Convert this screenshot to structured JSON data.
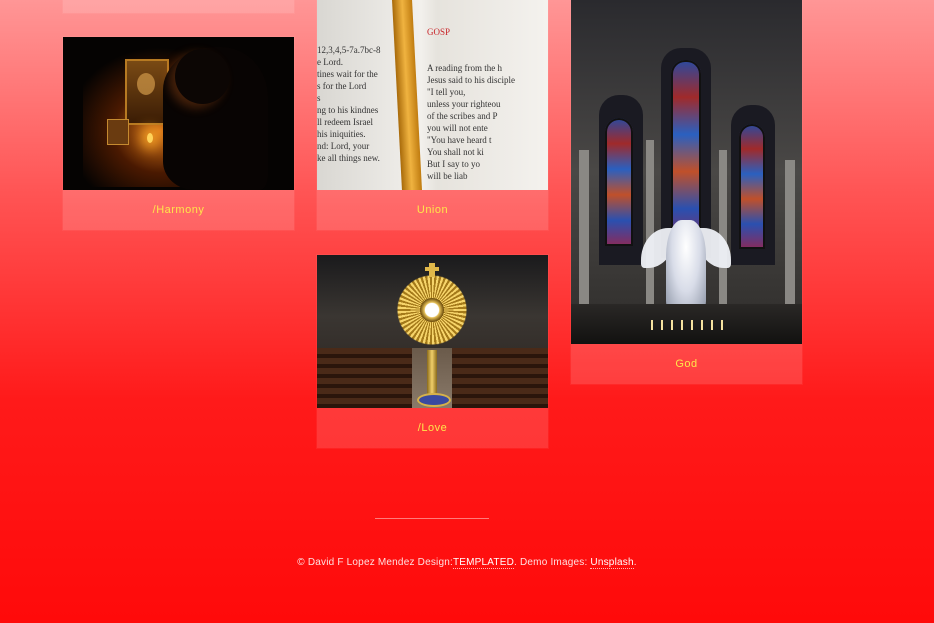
{
  "gallery": {
    "items": [
      {
        "caption": "/Harmony"
      },
      {
        "caption": "Union"
      },
      {
        "caption": "/Love"
      },
      {
        "caption": "God"
      }
    ]
  },
  "footer": {
    "copyright": "© David F Lopez Mendez",
    "design_label": "Design:",
    "design_link": "TEMPLATED",
    "images_label": ". Demo Images:",
    "images_link": "Unsplash",
    "end": "."
  },
  "book": {
    "left_lines": [
      "12,3,4,5-7a.7bc-8",
      "e Lord.",
      "tines wait for the",
      "",
      "s for the Lord",
      "s",
      "ng to his kindnes",
      "",
      "ll redeem Israel",
      "his iniquities.",
      "",
      "nd: Lord, your",
      "ke all things new.",
      ""
    ],
    "heading": "GOSP",
    "right_lines": [
      "A reading from the h",
      "Jesus said to his disciple",
      "\"I tell you,",
      "unless your righteou",
      "of the scribes and P",
      "you will not ente",
      "",
      "\"You have heard t",
      "You shall not ki",
      "But I say to yo",
      "will be liab"
    ]
  },
  "colors": {
    "background_top": "#ff9696",
    "background_bottom": "#ff0a0a",
    "caption": "#ffe64a"
  }
}
